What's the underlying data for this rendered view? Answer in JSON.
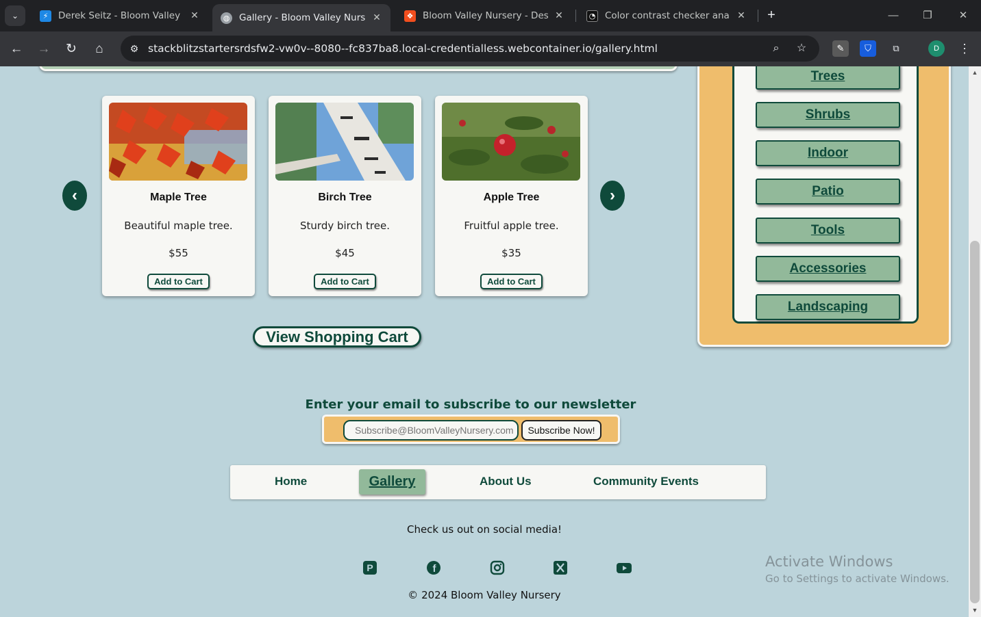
{
  "browser": {
    "tabs": [
      {
        "title": "Derek Seitz - Bloom Valley Nurs",
        "close": "✕",
        "favicon_color": "#1e88e5",
        "favicon_glyph": "⚡"
      },
      {
        "title": "Gallery - Bloom Valley Nursery",
        "close": "✕",
        "favicon_color": "#9aa0a6",
        "favicon_glyph": "◍"
      },
      {
        "title": "Bloom Valley Nursery - Desktop",
        "close": "✕",
        "favicon_color": "#f24e1e",
        "favicon_glyph": "❖"
      },
      {
        "title": "Color contrast checker analyzer",
        "close": "✕",
        "favicon_color": "#111111",
        "favicon_glyph": "◔"
      }
    ],
    "active_tab": 1,
    "url": "stackblitzstartersrdsfw2-vw0v--8080--fc837ba8.local-credentialless.webcontainer.io/gallery.html",
    "profile_initial": "D"
  },
  "products": [
    {
      "name": "Maple Tree",
      "description": "Beautiful maple tree.",
      "price": "$55",
      "button": "Add to Cart"
    },
    {
      "name": "Birch Tree",
      "description": "Sturdy birch tree.",
      "price": "$45",
      "button": "Add to Cart"
    },
    {
      "name": "Apple Tree",
      "description": "Fruitful apple tree.",
      "price": "$35",
      "button": "Add to Cart"
    }
  ],
  "view_cart_label": "View Shopping Cart",
  "categories": [
    "Trees",
    "Shrubs",
    "Indoor",
    "Patio",
    "Tools",
    "Accessories",
    "Landscaping"
  ],
  "newsletter": {
    "title": "Enter your email to subscribe to our newsletter",
    "placeholder": "Subscribe@BloomValleyNursery.com",
    "button": "Subscribe Now!"
  },
  "nav": {
    "items": [
      "Home",
      "Gallery",
      "About Us",
      "Community Events"
    ],
    "active": "Gallery"
  },
  "social": {
    "text": "Check us out on social media!",
    "icons": [
      "pinterest-icon",
      "facebook-icon",
      "instagram-icon",
      "x-icon",
      "youtube-icon"
    ]
  },
  "copyright": "© 2024 Bloom Valley Nursery",
  "watermark": {
    "line1": "Activate Windows",
    "line2": "Go to Settings to activate Windows."
  },
  "colors": {
    "page_bg": "#bcd4db",
    "dark_green": "#0f4a3b",
    "sage": "#92b99a",
    "gold": "#efbd6c",
    "card": "#f7f7f4"
  }
}
